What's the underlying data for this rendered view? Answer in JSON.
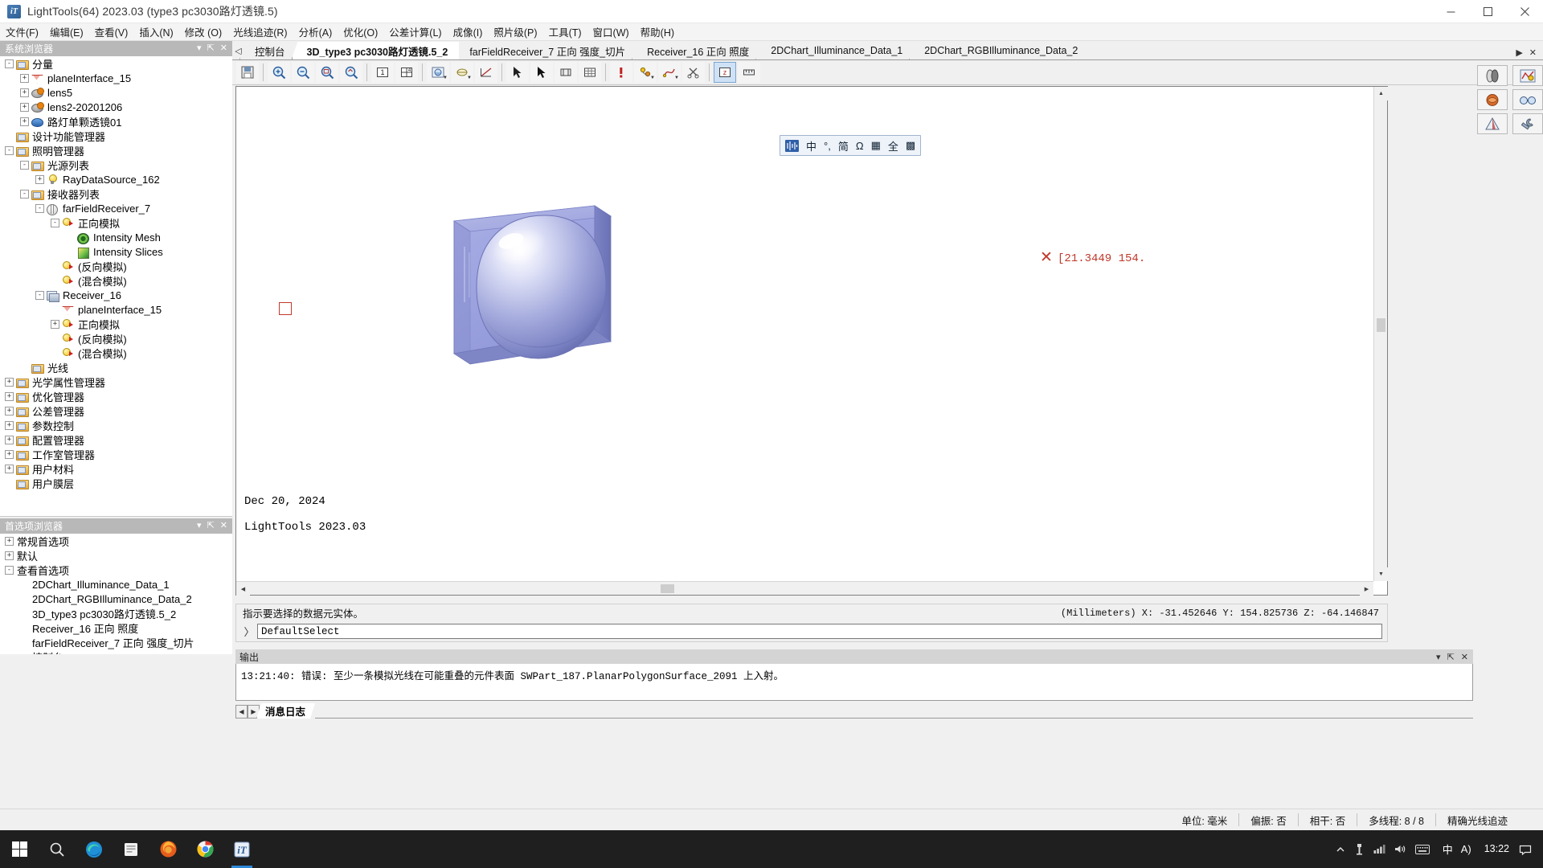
{
  "window": {
    "title": "LightTools(64) 2023.03  (type3 pc3030路灯透镜.5)",
    "icon_text": "iT",
    "minimize_label": "最小化",
    "maximize_label": "最大化",
    "close_label": "关闭"
  },
  "menubar": {
    "items": [
      "文件(F)",
      "编辑(E)",
      "查看(V)",
      "插入(N)",
      "修改 (O)",
      "光线追迹(R)",
      "分析(A)",
      "优化(O)",
      "公差计算(L)",
      "成像(I)",
      "照片级(P)",
      "工具(T)",
      "窗口(W)",
      "帮助(H)"
    ]
  },
  "system_browser": {
    "title": "系统浏览器",
    "nodes": [
      {
        "label": "分量",
        "depth": 0,
        "exp": "-",
        "icon": "folder"
      },
      {
        "label": "planeInterface_15",
        "depth": 1,
        "exp": "+",
        "icon": "tri"
      },
      {
        "label": "lens5",
        "depth": 1,
        "exp": "+",
        "icon": "lens"
      },
      {
        "label": "lens2-20201206",
        "depth": 1,
        "exp": "+",
        "icon": "lens"
      },
      {
        "label": "路灯单颗透镜01",
        "depth": 1,
        "exp": "+",
        "icon": "blue3d"
      },
      {
        "label": "设计功能管理器",
        "depth": 0,
        "exp": "",
        "icon": "folder"
      },
      {
        "label": "照明管理器",
        "depth": 0,
        "exp": "-",
        "icon": "folder"
      },
      {
        "label": "光源列表",
        "depth": 1,
        "exp": "-",
        "icon": "folder"
      },
      {
        "label": "RayDataSource_162",
        "depth": 2,
        "exp": "+",
        "icon": "bulb"
      },
      {
        "label": "接收器列表",
        "depth": 1,
        "exp": "-",
        "icon": "folder"
      },
      {
        "label": "farFieldReceiver_7",
        "depth": 2,
        "exp": "-",
        "icon": "sphere-grid"
      },
      {
        "label": "正向模拟",
        "depth": 3,
        "exp": "-",
        "icon": "bulb-arrow"
      },
      {
        "label": "Intensity Mesh",
        "depth": 4,
        "exp": "",
        "icon": "mesh"
      },
      {
        "label": "Intensity Slices",
        "depth": 4,
        "exp": "",
        "icon": "slices"
      },
      {
        "label": "(反向模拟)",
        "depth": 3,
        "exp": "",
        "icon": "bulb-arrow"
      },
      {
        "label": "(混合模拟)",
        "depth": 3,
        "exp": "",
        "icon": "bulb-arrow"
      },
      {
        "label": "Receiver_16",
        "depth": 2,
        "exp": "-",
        "icon": "receiver"
      },
      {
        "label": "planeInterface_15",
        "depth": 3,
        "exp": "",
        "icon": "tri"
      },
      {
        "label": "正向模拟",
        "depth": 3,
        "exp": "+",
        "icon": "bulb-arrow"
      },
      {
        "label": "(反向模拟)",
        "depth": 3,
        "exp": "",
        "icon": "bulb-arrow"
      },
      {
        "label": "(混合模拟)",
        "depth": 3,
        "exp": "",
        "icon": "bulb-arrow"
      },
      {
        "label": "光线",
        "depth": 1,
        "exp": "",
        "icon": "folder"
      },
      {
        "label": "光学属性管理器",
        "depth": 0,
        "exp": "+",
        "icon": "folder"
      },
      {
        "label": "优化管理器",
        "depth": 0,
        "exp": "+",
        "icon": "folder"
      },
      {
        "label": "公差管理器",
        "depth": 0,
        "exp": "+",
        "icon": "folder"
      },
      {
        "label": "参数控制",
        "depth": 0,
        "exp": "+",
        "icon": "folder"
      },
      {
        "label": "配置管理器",
        "depth": 0,
        "exp": "+",
        "icon": "folder"
      },
      {
        "label": "工作室管理器",
        "depth": 0,
        "exp": "+",
        "icon": "folder"
      },
      {
        "label": "用户材料",
        "depth": 0,
        "exp": "+",
        "icon": "folder"
      },
      {
        "label": "用户膜层",
        "depth": 0,
        "exp": "",
        "icon": "folder"
      }
    ]
  },
  "preference_browser": {
    "title": "首选项浏览器",
    "nodes": [
      {
        "label": "常规首选项",
        "depth": 0,
        "exp": "+"
      },
      {
        "label": "默认",
        "depth": 0,
        "exp": "+"
      },
      {
        "label": "查看首选项",
        "depth": 0,
        "exp": "-"
      },
      {
        "label": "2DChart_Illuminance_Data_1",
        "depth": 1,
        "exp": ""
      },
      {
        "label": "2DChart_RGBIlluminance_Data_2",
        "depth": 1,
        "exp": ""
      },
      {
        "label": "3D_type3 pc3030路灯透镜.5_2",
        "depth": 1,
        "exp": ""
      },
      {
        "label": "Receiver_16 正向 照度",
        "depth": 1,
        "exp": ""
      },
      {
        "label": "farFieldReceiver_7 正向 强度_切片",
        "depth": 1,
        "exp": ""
      },
      {
        "label": "控制台",
        "depth": 1,
        "exp": ""
      }
    ]
  },
  "tabs": {
    "prev_label": "◁",
    "items": [
      {
        "label": "控制台",
        "active": false
      },
      {
        "label": "3D_type3 pc3030路灯透镜.5_2",
        "active": true
      },
      {
        "label": "farFieldReceiver_7 正向 强度_切片",
        "active": false
      },
      {
        "label": "Receiver_16 正向 照度",
        "active": false
      },
      {
        "label": "2DChart_Illuminance_Data_1",
        "active": false
      },
      {
        "label": "2DChart_RGBIlluminance_Data_2",
        "active": false
      }
    ],
    "float_label": "▶",
    "close_label": "✕"
  },
  "toolbar": {
    "buttons": [
      {
        "name": "save-icon",
        "glyph": "save"
      },
      {
        "name": "zoom-in-icon",
        "glyph": "zoom-in"
      },
      {
        "name": "zoom-out-icon",
        "glyph": "zoom-out"
      },
      {
        "name": "zoom-window-icon",
        "glyph": "zoom-window"
      },
      {
        "name": "zoom-fit-icon",
        "glyph": "zoom-fit"
      },
      {
        "name": "view-1-icon",
        "glyph": "view1"
      },
      {
        "name": "view-4-icon",
        "glyph": "view4"
      },
      {
        "name": "render-mode-icon",
        "glyph": "render",
        "caret": true
      },
      {
        "name": "lighting-icon",
        "glyph": "light",
        "caret": true
      },
      {
        "name": "ray-trace-icon",
        "glyph": "raytrace"
      },
      {
        "name": "pointer-tool-icon",
        "glyph": "arrow-sel"
      },
      {
        "name": "select-arrow-icon",
        "glyph": "arrow"
      },
      {
        "name": "pan-icon",
        "glyph": "pan"
      },
      {
        "name": "grid-icon",
        "glyph": "grid"
      },
      {
        "name": "exclaim-icon",
        "glyph": "bang"
      },
      {
        "name": "annotate-icon",
        "glyph": "annotate",
        "caret": true
      },
      {
        "name": "curve-icon",
        "glyph": "curve",
        "caret": true
      },
      {
        "name": "scissors-icon",
        "glyph": "scissors"
      },
      {
        "name": "z-axis-icon",
        "glyph": "zaxis"
      },
      {
        "name": "measure-icon",
        "glyph": "measure"
      }
    ],
    "right_buttons": [
      {
        "name": "capsule-icon",
        "glyph": "capsule"
      },
      {
        "name": "chart-icon",
        "glyph": "chart"
      },
      {
        "name": "render3d-icon",
        "glyph": "render3d"
      },
      {
        "name": "glasses-icon",
        "glyph": "glasses"
      },
      {
        "name": "cone-icon",
        "glyph": "cone"
      },
      {
        "name": "wrench-icon",
        "glyph": "wrench"
      }
    ]
  },
  "viewport": {
    "float_toolbar": [
      "wave-icon",
      "中",
      "°,",
      "简",
      "Ω",
      "▦",
      "全",
      "▩"
    ],
    "date_text": "Dec 20,  2024",
    "version_text": "LightTools 2023.03",
    "coordinate_readout": "[21.3449  154.",
    "marker_glyph": "✕"
  },
  "status": {
    "prompt": "指示要选择的数据元实体。",
    "coordinates": "(Millimeters) X: -31.452646 Y: 154.825736 Z: -64.146847",
    "command_prompt": "〉",
    "command_value": "DefaultSelect",
    "command_placeholder": ""
  },
  "output": {
    "title": "输出",
    "log_line": "13:21:40: 错误: 至少一条模拟光线在可能重叠的元件表面 SWPart_187.PlanarPolygonSurface_2091 上入射。",
    "tabs": [
      {
        "label": "消息日志",
        "active": true
      }
    ],
    "nav_prev": "◀",
    "nav_next": "▶"
  },
  "appstatus": {
    "cells": [
      "单位: 毫米",
      "偏振: 否",
      "相干: 否",
      "多线程: 8 / 8",
      "精确光线追迹"
    ]
  },
  "taskbar": {
    "icons": [
      "start-icon",
      "search-icon",
      "edge-icon",
      "file-explorer-icon",
      "firefox-icon",
      "chrome-icon",
      "lighttools-icon"
    ],
    "tray": [
      "chevron-up-icon",
      "usb-icon",
      "network-icon",
      "volume-icon",
      "keyboard-icon"
    ],
    "ime_primary": "中",
    "ime_secondary": "A)",
    "clock_time": "13:22",
    "notification_icon": "notification-icon"
  }
}
